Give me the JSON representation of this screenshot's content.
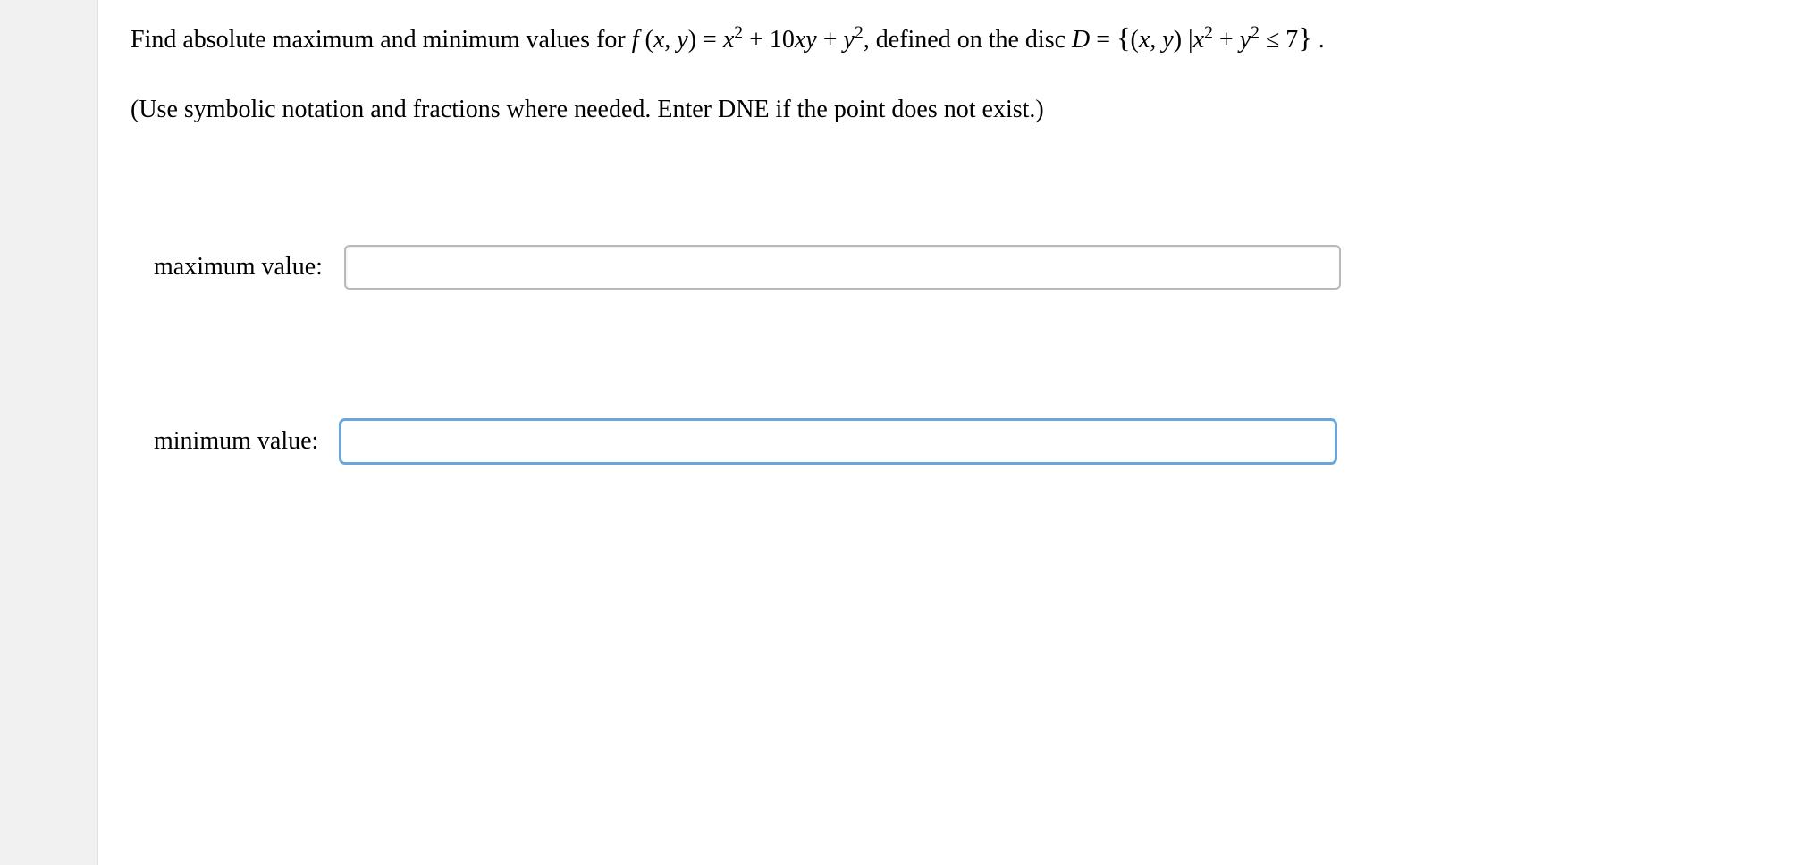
{
  "problem": {
    "prefix": "Find absolute maximum and minimum values for ",
    "f_open": "f",
    "f_args_open": " (",
    "f_arg_x": "x",
    "f_args_sep": ", ",
    "f_arg_y": "y",
    "f_args_close": ") = ",
    "term_x2_var": "x",
    "term_x2_sup": "2",
    "plus1": " + 10",
    "term_xy_x": "x",
    "term_xy_y": "y",
    "plus2": " + ",
    "term_y2_var": "y",
    "term_y2_sup": "2",
    "defined_on": ", defined on the disc ",
    "D": "D",
    "equals": " = ",
    "lbrace": "{",
    "set_open": "(",
    "set_x": "x",
    "set_sep": ", ",
    "set_y": "y",
    "set_close": ") |",
    "cond_x": "x",
    "cond_x_sup": "2",
    "cond_plus": " + ",
    "cond_y": "y",
    "cond_y_sup": "2",
    "cond_leq": " ≤ 7",
    "rbrace": "}",
    "period": " ."
  },
  "instruction": "(Use symbolic notation and fractions where needed. Enter DNE if the point does not exist.)",
  "answers": {
    "max_label": "maximum value:",
    "max_value": "",
    "min_label": "minimum value:",
    "min_value": ""
  }
}
